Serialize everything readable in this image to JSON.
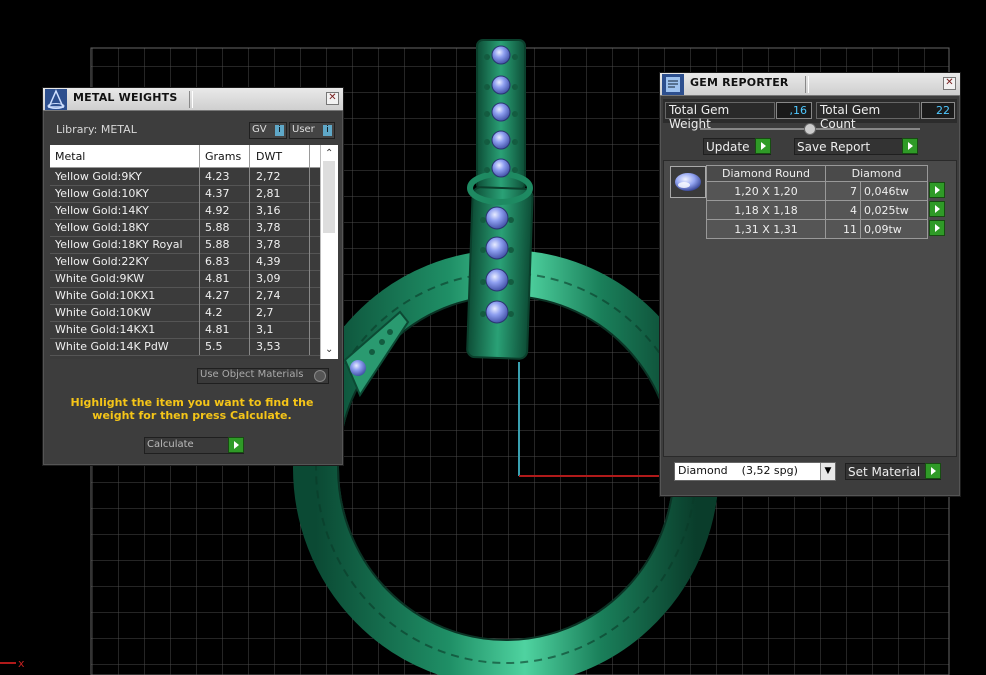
{
  "metal_panel": {
    "title": "METAL WEIGHTS",
    "library_label": "Library: METAL",
    "gv_toggle": "GV",
    "user_toggle": "User",
    "columns": [
      "Metal",
      "Grams",
      "DWT"
    ],
    "rows": [
      {
        "metal": "Yellow Gold:9KY",
        "grams": "4.23",
        "dwt": "2,72"
      },
      {
        "metal": "Yellow Gold:10KY",
        "grams": "4.37",
        "dwt": "2,81"
      },
      {
        "metal": "Yellow Gold:14KY",
        "grams": "4.92",
        "dwt": "3,16"
      },
      {
        "metal": "Yellow Gold:18KY",
        "grams": "5.88",
        "dwt": "3,78"
      },
      {
        "metal": "Yellow Gold:18KY Royal",
        "grams": "5.88",
        "dwt": "3,78"
      },
      {
        "metal": "Yellow Gold:22KY",
        "grams": "6.83",
        "dwt": "4,39"
      },
      {
        "metal": "White Gold:9KW",
        "grams": "4.81",
        "dwt": "3,09"
      },
      {
        "metal": "White Gold:10KX1",
        "grams": "4.27",
        "dwt": "2,74"
      },
      {
        "metal": "White Gold:10KW",
        "grams": "4.2",
        "dwt": "2,7"
      },
      {
        "metal": "White Gold:14KX1",
        "grams": "4.81",
        "dwt": "3,1"
      },
      {
        "metal": "White Gold:14K PdW",
        "grams": "5.5",
        "dwt": "3,53"
      }
    ],
    "use_object_materials_label": "Use Object Materials",
    "instruction": "Highlight the item you want to find the weight for then press Calculate.",
    "calculate_label": "Calculate"
  },
  "gem_panel": {
    "title": "GEM REPORTER",
    "total_weight_label": "Total Gem Weight",
    "total_weight_value": ",16",
    "total_count_label": "Total Gem Count",
    "total_count_value": "22",
    "update_label": "Update",
    "save_report_label": "Save Report",
    "table_header": [
      "Diamond Round",
      "Diamond"
    ],
    "rows": [
      {
        "size": "1,20 X 1,20",
        "count": "7",
        "weight": "0,046tw"
      },
      {
        "size": "1,18 X 1,18",
        "count": "4",
        "weight": "0,025tw"
      },
      {
        "size": "1,31 X 1,31",
        "count": "11",
        "weight": "0,09tw"
      }
    ],
    "material_select": "Diamond    (3,52 spg)",
    "set_material_label": "Set Material"
  },
  "axis_label": "x",
  "colors": {
    "ring_green": "#1f8f66",
    "gem_blue": "#7f90e8",
    "yellow_text": "#f5c518",
    "grid": "#4a4a4a",
    "accent_green": "#2f9a27"
  },
  "icons": [
    "metal-weights-icon",
    "gem-reporter-icon",
    "close-icon",
    "play-arrow-icon",
    "scroll-up-icon",
    "scroll-down-icon",
    "dropdown-arrow-icon",
    "gem-thumbnail-icon",
    "info-icon"
  ]
}
